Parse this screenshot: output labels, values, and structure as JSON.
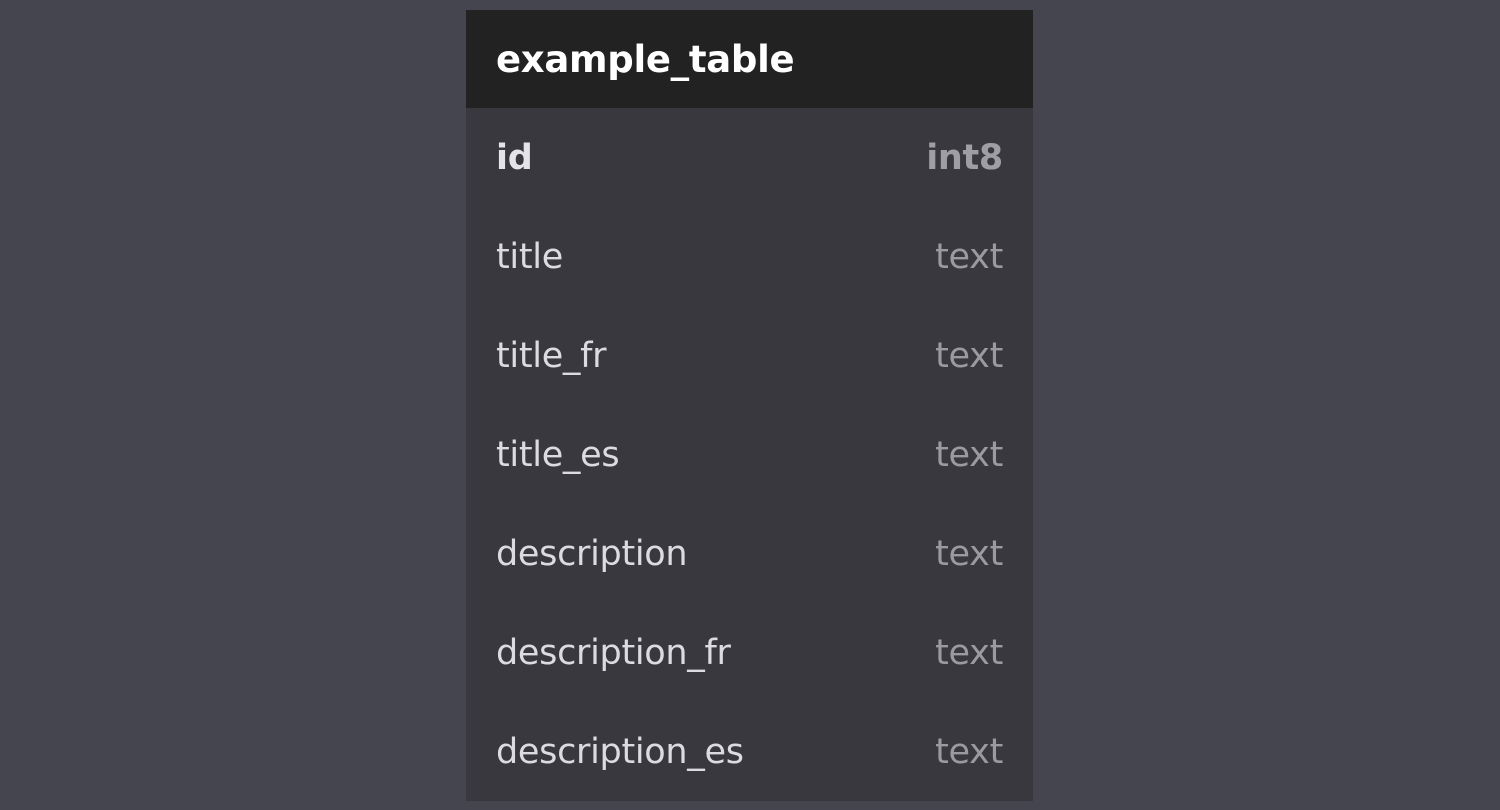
{
  "table": {
    "name": "example_table",
    "columns": [
      {
        "name": "id",
        "type": "int8",
        "primary": true
      },
      {
        "name": "title",
        "type": "text",
        "primary": false
      },
      {
        "name": "title_fr",
        "type": "text",
        "primary": false
      },
      {
        "name": "title_es",
        "type": "text",
        "primary": false
      },
      {
        "name": "description",
        "type": "text",
        "primary": false
      },
      {
        "name": "description_fr",
        "type": "text",
        "primary": false
      },
      {
        "name": "description_es",
        "type": "text",
        "primary": false
      }
    ]
  },
  "colors": {
    "background": "#45454f",
    "header": "#222222",
    "body": "#38383e"
  }
}
